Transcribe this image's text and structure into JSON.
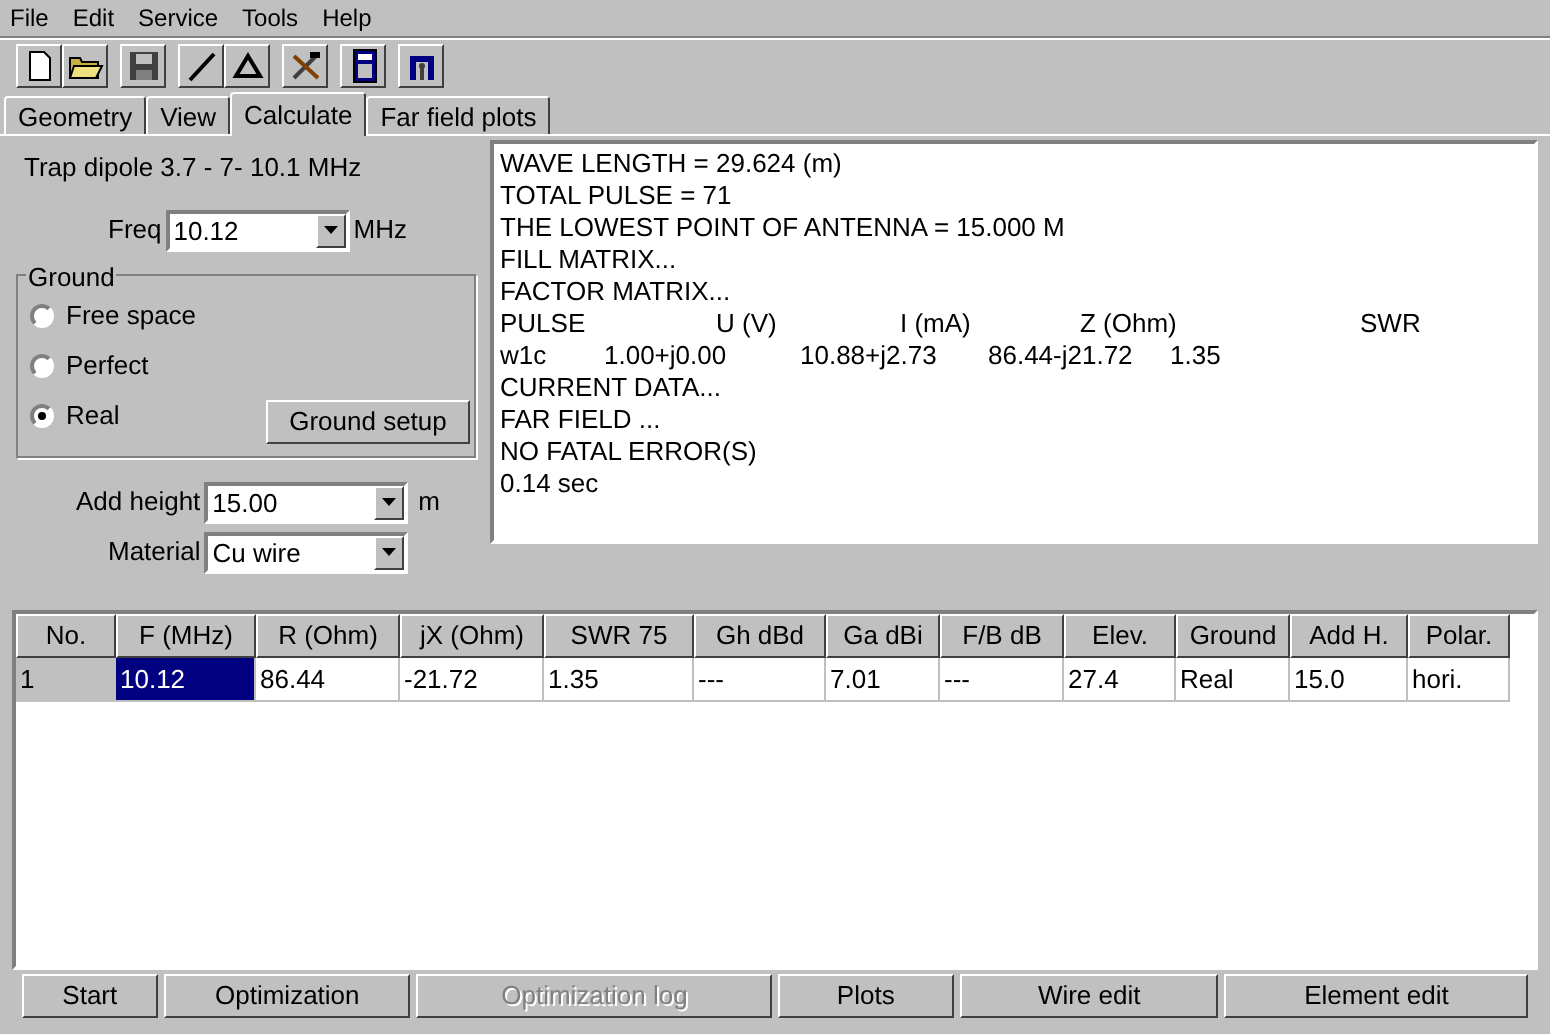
{
  "menu": [
    "File",
    "Edit",
    "Service",
    "Tools",
    "Help"
  ],
  "tabs": [
    {
      "label": "Geometry",
      "selected": false
    },
    {
      "label": "View",
      "selected": false
    },
    {
      "label": "Calculate",
      "selected": true
    },
    {
      "label": "Far field plots",
      "selected": false
    }
  ],
  "title": "Trap dipole 3.7 - 7- 10.1 MHz",
  "freq": {
    "label": "Freq",
    "value": "10.12",
    "unit": "MHz"
  },
  "ground": {
    "title": "Ground",
    "options": [
      {
        "label": "Free space",
        "selected": false
      },
      {
        "label": "Perfect",
        "selected": false
      },
      {
        "label": "Real",
        "selected": true
      }
    ],
    "button": "Ground setup"
  },
  "add_height": {
    "label": "Add height",
    "value": "15.00",
    "unit": "m"
  },
  "material": {
    "label": "Material",
    "value": "Cu wire"
  },
  "output": [
    {
      "kind": "text",
      "text": "WAVE LENGTH = 29.624 (m)"
    },
    {
      "kind": "text",
      "text": "TOTAL PULSE = 71"
    },
    {
      "kind": "text",
      "text": "THE LOWEST POINT OF ANTENNA = 15.000 M"
    },
    {
      "kind": "text",
      "text": "FILL MATRIX..."
    },
    {
      "kind": "text",
      "text": "FACTOR MATRIX..."
    },
    {
      "kind": "header",
      "cells": [
        "PULSE",
        "U (V)",
        "I (mA)",
        "Z (Ohm)",
        "SWR"
      ]
    },
    {
      "kind": "values",
      "cells": [
        "w1c",
        "1.00+j0.00",
        "10.88+j2.73",
        "86.44-j21.72",
        "1.35"
      ]
    },
    {
      "kind": "text",
      "text": "CURRENT DATA..."
    },
    {
      "kind": "text",
      "text": "FAR FIELD ..."
    },
    {
      "kind": "text",
      "text": "NO FATAL ERROR(S)"
    },
    {
      "kind": "text",
      "text": "0.14 sec"
    }
  ],
  "table": {
    "columns": [
      "No.",
      "F (MHz)",
      "R (Ohm)",
      "jX (Ohm)",
      "SWR 75",
      "Gh dBd",
      "Ga dBi",
      "F/B dB",
      "Elev.",
      "Ground",
      "Add H.",
      "Polar."
    ],
    "rows": [
      {
        "cells": [
          {
            "text": "1",
            "selected": false
          },
          {
            "text": "10.12",
            "selected": true
          },
          {
            "text": "86.44",
            "selected": false
          },
          {
            "text": "-21.72",
            "selected": false
          },
          {
            "text": "1.35",
            "selected": false
          },
          {
            "text": "---",
            "selected": false
          },
          {
            "text": "7.01",
            "selected": false
          },
          {
            "text": "---",
            "selected": false
          },
          {
            "text": "27.4",
            "selected": false
          },
          {
            "text": "Real",
            "selected": false
          },
          {
            "text": "15.0",
            "selected": false
          },
          {
            "text": "hori.",
            "selected": false
          }
        ]
      }
    ]
  },
  "buttons": [
    {
      "label": "Start",
      "disabled": false
    },
    {
      "label": "Optimization",
      "disabled": false
    },
    {
      "label": "Optimization log",
      "disabled": true
    },
    {
      "label": "Plots",
      "disabled": false
    },
    {
      "label": "Wire edit",
      "disabled": false
    },
    {
      "label": "Element edit",
      "disabled": false
    }
  ]
}
